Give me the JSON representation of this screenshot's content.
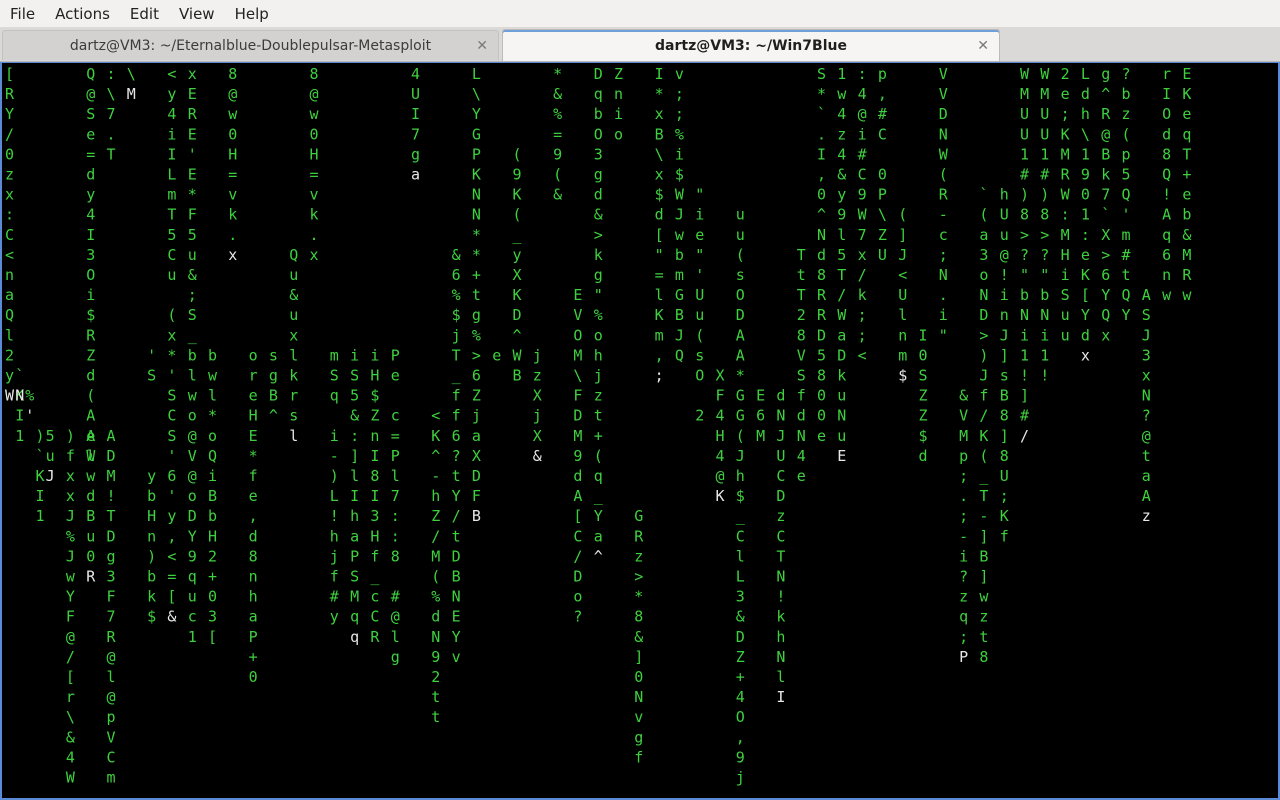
{
  "menu": {
    "items": [
      "File",
      "Actions",
      "Edit",
      "View",
      "Help"
    ]
  },
  "tabs": [
    {
      "label": "dartz@VM3: ~/Eternalblue-Doublepulsar-Metasploit",
      "active": false,
      "close_icon": "close-icon"
    },
    {
      "label": "dartz@VM3: ~/Win7Blue",
      "active": true,
      "close_icon": "close-icon"
    }
  ],
  "colors": {
    "green": "#3ed13e",
    "white": "#e8e8e8",
    "terminal_bg": "#000000",
    "accent": "#5b8bd6"
  },
  "terminal": {
    "effect": "matrix-rain",
    "columns": [
      {
        "c": 0,
        "r": 0,
        "t": "[RY/0zx:C<naQl2yW"
      },
      {
        "c": 1,
        "r": 16,
        "t": "K"
      },
      {
        "c": 1,
        "r": 17,
        "t": "I1"
      },
      {
        "c": 1,
        "r": 16,
        "t": "N"
      },
      {
        "c": 1,
        "r": 15,
        "t": "`"
      },
      {
        "c": 2,
        "r": 16,
        "t": "%"
      },
      {
        "c": 2,
        "r": 17,
        "t": "'"
      },
      {
        "c": 3,
        "r": 18,
        "t": ")`KI1"
      },
      {
        "c": 4,
        "r": 2,
        "t": "   "
      },
      {
        "c": 4,
        "r": 18,
        "t": "5uJ"
      },
      {
        "c": 6,
        "r": 18,
        "t": ")fxxJ%JwYF@/[r\\&4WZ_J"
      },
      {
        "c": 8,
        "r": 0,
        "t": "Q@Se=dy4I3Oi$RZd(AeW"
      },
      {
        "c": 8,
        "r": 18,
        "t": "AlwdBu0R"
      },
      {
        "c": 10,
        "r": 0,
        "t": ":\\7.T"
      },
      {
        "c": 10,
        "r": 18,
        "t": "ADM!TDg3F7R@l@pVCmS"
      },
      {
        "c": 12,
        "r": 0,
        "t": "\\M"
      },
      {
        "c": 14,
        "r": 14,
        "t": "'S"
      },
      {
        "c": 14,
        "r": 20,
        "t": "ybHn)bk$"
      },
      {
        "c": 16,
        "r": 0,
        "t": "<y4iILmT5Cu (x*'SCS'6'y,<=[&"
      },
      {
        "c": 18,
        "r": 0,
        "t": "xERE'E*F5u&;S_blwo@V@oDY9quc1"
      },
      {
        "c": 20,
        "r": 14,
        "t": "bwl*oQiBbH2+03["
      },
      {
        "c": 22,
        "r": 0,
        "t": "8@w0H=vk.x"
      },
      {
        "c": 24,
        "r": 14,
        "t": "oreHE*fe,d8nhaP+0"
      },
      {
        "c": 26,
        "r": 14,
        "t": "sgB^"
      },
      {
        "c": 28,
        "r": 9,
        "t": "Qu&uxlkrsl"
      },
      {
        "c": 30,
        "r": 0,
        "t": "8@w0H=vk.x"
      },
      {
        "c": 32,
        "r": 14,
        "t": "mSq i-)L!hjf#y"
      },
      {
        "c": 34,
        "r": 14,
        "t": "iS5&:]lIhaPSMqq"
      },
      {
        "c": 36,
        "r": 14,
        "t": "iH$ZnI8I3Hf_cCR"
      },
      {
        "c": 38,
        "r": 14,
        "t": "Pe c=Pl7::8 #@lg"
      },
      {
        "c": 40,
        "r": 0,
        "t": "4UI7ga"
      },
      {
        "c": 42,
        "r": 17,
        "t": "<K^-hZ/M(%dN92tt"
      },
      {
        "c": 44,
        "r": 9,
        "t": "&6%$jT_ff6?tY/tDBNEYv"
      },
      {
        "c": 46,
        "r": 0,
        "t": "L\\YGPKNN**+tg%>6ZjaXDFB"
      },
      {
        "c": 48,
        "r": 14,
        "t": "e"
      },
      {
        "c": 50,
        "r": 4,
        "t": "(9K(_yXKD^WB"
      },
      {
        "c": 52,
        "r": 14,
        "t": "jzXjX&"
      },
      {
        "c": 54,
        "r": 0,
        "t": "*&%=9(&"
      },
      {
        "c": 56,
        "r": 11,
        "t": "EVOM\\FDM9dA[C/Do?"
      },
      {
        "c": 58,
        "r": 0,
        "t": "DqbO3gd&>kg\"%ohjzt+(q_Ya^"
      },
      {
        "c": 60,
        "r": 0,
        "t": "Znio"
      },
      {
        "c": 62,
        "r": 22,
        "t": "GRz>*8&]0Nvgf"
      },
      {
        "c": 64,
        "r": 0,
        "t": "I*xB\\x$d[\"=lKm,;"
      },
      {
        "c": 66,
        "r": 0,
        "t": "v;;%i$WJwbmGBJQ"
      },
      {
        "c": 68,
        "r": 6,
        "t": "\"ie\"'Uu(sO 2"
      },
      {
        "c": 70,
        "r": 15,
        "t": "XF4H4@K"
      },
      {
        "c": 72,
        "r": 7,
        "t": "uu(sODAA*GG(Jh$_ClL3&DZ+4O,9jF)"
      },
      {
        "c": 74,
        "r": 16,
        "t": "E6M"
      },
      {
        "c": 76,
        "r": 16,
        "t": "dNJUCDzCTN!khNlI"
      },
      {
        "c": 78,
        "r": 9,
        "t": "TtT28VSfdN4e"
      },
      {
        "c": 80,
        "r": 0,
        "t": "S*`.I,0^Nd8RRD5800e"
      },
      {
        "c": 82,
        "r": 0,
        "t": "1w4z4&y9l5T/WaDkuNuE"
      },
      {
        "c": 84,
        "r": 0,
        "t": ":4@i#C9W7x/k;;<"
      },
      {
        "c": 86,
        "r": 0,
        "t": "p,#C 0P\\ZU"
      },
      {
        "c": 88,
        "r": 7,
        "t": "(]J<Ulnm$"
      },
      {
        "c": 90,
        "r": 13,
        "t": "I0SZZ$d"
      },
      {
        "c": 92,
        "r": 0,
        "t": "VVDNW(R-c;N.i\""
      },
      {
        "c": 94,
        "r": 16,
        "t": "&VMp;.;-i?zq;P"
      },
      {
        "c": 96,
        "r": 6,
        "t": "`(a3oND>)Jf/K(_T-]B]wzt8"
      },
      {
        "c": 98,
        "r": 6,
        "t": "hUu@!inJ]sB8]8U;Kf"
      },
      {
        "c": 100,
        "r": 0,
        "t": "WMUU1#)8>?\"bNi1!]#/"
      },
      {
        "c": 102,
        "r": 0,
        "t": "WMUU1#)8>?\"bNi1!"
      },
      {
        "c": 104,
        "r": 0,
        "t": "2e;KMRW:MHiSuu"
      },
      {
        "c": 106,
        "r": 0,
        "t": "Ldh\\1901:eK[Ydx"
      },
      {
        "c": 108,
        "r": 0,
        "t": "g^R@Bk7`X>6YQx"
      },
      {
        "c": 110,
        "r": 0,
        "t": "?bz(p5Q'm#tQY"
      },
      {
        "c": 112,
        "r": 11,
        "t": "ASJ3xN?@taAz"
      },
      {
        "c": 114,
        "r": 0,
        "t": "rIOd8Q!Aq6nw"
      },
      {
        "c": 116,
        "r": 0,
        "t": "EKeqT+eb&MRw"
      }
    ]
  }
}
